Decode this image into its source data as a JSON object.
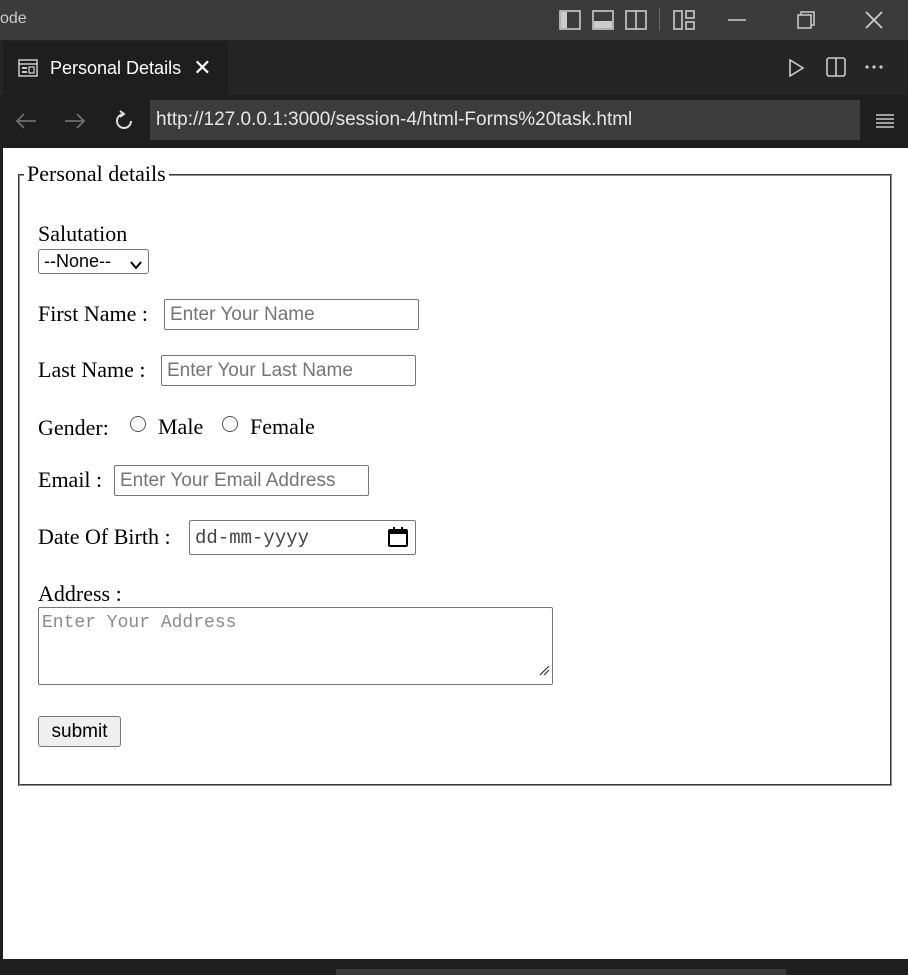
{
  "window": {
    "app_name": "ode"
  },
  "tab": {
    "title": "Personal Details",
    "close_glyph": "✕"
  },
  "browser": {
    "url": "http://127.0.0.1:3000/session-4/html-Forms%20task.html"
  },
  "form": {
    "legend": "Personal details",
    "salutation_label": "Salutation",
    "salutation_selected": "--None--",
    "first_name_label": "First Name :",
    "first_name_placeholder": "Enter Your Name",
    "last_name_label": "Last Name :",
    "last_name_placeholder": "Enter Your Last Name",
    "gender_label": "Gender:",
    "gender_options": [
      "Male",
      "Female"
    ],
    "email_label": "Email :",
    "email_placeholder": "Enter Your Email Address",
    "dob_label": "Date Of Birth :",
    "dob_placeholder": "dd-mm-yyyy",
    "address_label": "Address :",
    "address_placeholder": "Enter Your Address",
    "submit_label": "submit"
  },
  "colors": {
    "titlebar": "#3b3b3b",
    "editor_bg": "#1e1e1e",
    "url_box": "#3c3c3c",
    "page_bg": "#ffffff"
  }
}
